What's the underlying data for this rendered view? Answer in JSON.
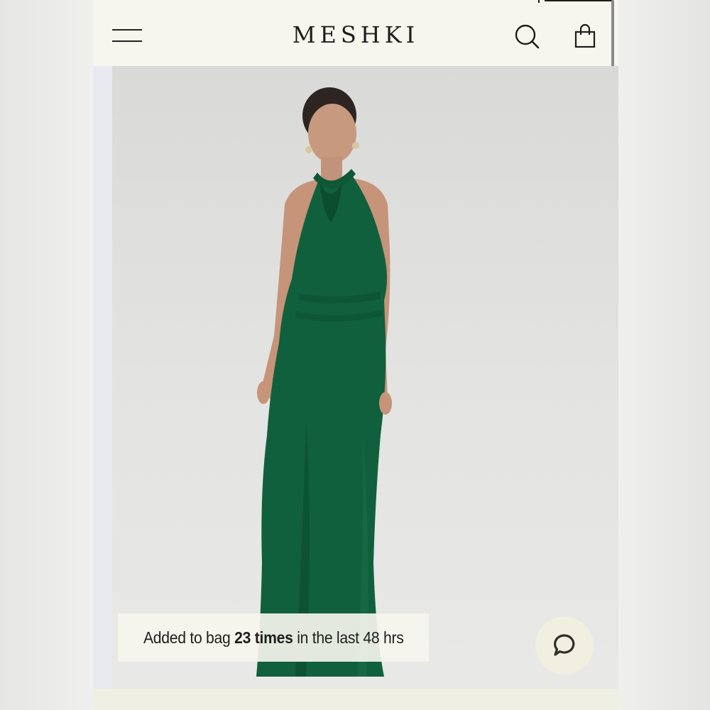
{
  "header": {
    "brand": "MESHKI",
    "menu_icon": "hamburger-menu-icon",
    "search_icon": "search-icon",
    "bag_icon": "shopping-bag-icon"
  },
  "product": {
    "image_alt": "Model wearing emerald green halter neck maxi dress",
    "dress_color": "#11603d"
  },
  "toast": {
    "prefix": "Added to bag ",
    "count_text": "23 times",
    "suffix": " in the last 48 hrs"
  },
  "chat": {
    "icon": "chat-bubble-icon"
  },
  "colors": {
    "header_bg": "#f7f6ee",
    "hero_bg": "#dcdcda",
    "accent_green": "#11603d"
  }
}
